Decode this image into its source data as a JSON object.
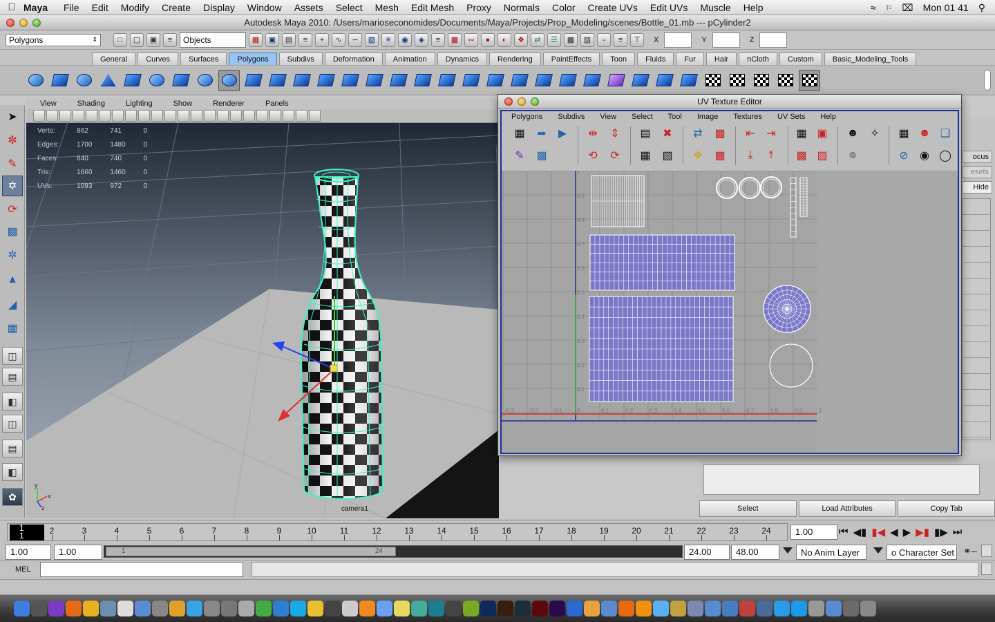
{
  "mac_menubar": {
    "app_name": "Maya",
    "items": [
      "File",
      "Edit",
      "Modify",
      "Create",
      "Display",
      "Window",
      "Assets",
      "Select",
      "Mesh",
      "Edit Mesh",
      "Proxy",
      "Normals",
      "Color",
      "Create UVs",
      "Edit UVs",
      "Muscle",
      "Help"
    ],
    "clock": "Mon 01 41"
  },
  "window": {
    "title": "Autodesk Maya 2010: /Users/marioseconomides/Documents/Maya/Projects/Prop_Modeling/scenes/Bottle_01.mb   ---   pCylinder2"
  },
  "status_line": {
    "menu_set": "Polygons",
    "selection_mode": "Objects",
    "x_label": "X",
    "y_label": "Y",
    "z_label": "Z"
  },
  "shelf_tabs": [
    "General",
    "Curves",
    "Surfaces",
    "Polygons",
    "Subdivs",
    "Deformation",
    "Animation",
    "Dynamics",
    "Rendering",
    "PaintEffects",
    "Toon",
    "Fluids",
    "Fur",
    "Hair",
    "nCloth",
    "Custom",
    "Basic_Modeling_Tools"
  ],
  "active_shelf_tab": "Polygons",
  "viewport": {
    "menu": [
      "View",
      "Shading",
      "Lighting",
      "Show",
      "Renderer",
      "Panels"
    ],
    "hud": [
      {
        "label": "Verts:",
        "a": "862",
        "b": "741",
        "c": "0"
      },
      {
        "label": "Edges:",
        "a": "1700",
        "b": "1480",
        "c": "0"
      },
      {
        "label": "Faces:",
        "a": "840",
        "b": "740",
        "c": "0"
      },
      {
        "label": "Tris:",
        "a": "1660",
        "b": "1460",
        "c": "0"
      },
      {
        "label": "UVs:",
        "a": "1093",
        "b": "972",
        "c": "0"
      }
    ],
    "camera_label": "camera1",
    "axis_labels": {
      "x": "x",
      "y": "y",
      "z": "z"
    },
    "grid_color": "#5e6a7a",
    "selection_color": "#3ef2c6"
  },
  "uv_editor": {
    "title": "UV Texture Editor",
    "menu": [
      "Polygons",
      "Subdivs",
      "View",
      "Select",
      "Tool",
      "Image",
      "Textures",
      "UV Sets",
      "Help"
    ],
    "v_labels": [
      "1",
      "0.9",
      "0.8",
      "0.7",
      "0.6",
      "0.5",
      "0.4",
      "0.3",
      "0.2",
      "0.1"
    ],
    "u_labels": [
      "-0.3",
      "-0.2",
      "-0.1",
      "0",
      "0.1",
      "0.2",
      "0.3",
      "0.4",
      "0.5",
      "0.6",
      "0.7",
      "0.8",
      "0.9",
      "1"
    ],
    "shell_fill": "#7b78c8"
  },
  "attribute_editor": {
    "tabs": [
      "ocus",
      "esets"
    ],
    "hide_button": "Hide",
    "buttons": [
      "Select",
      "Load Attributes",
      "Copy Tab"
    ]
  },
  "time_slider": {
    "frame_labels": [
      "2",
      "3",
      "4",
      "5",
      "6",
      "7",
      "8",
      "9",
      "10",
      "11",
      "12",
      "13",
      "14",
      "15",
      "16",
      "17",
      "18",
      "19",
      "20",
      "21",
      "22",
      "23",
      "24"
    ],
    "current_frame": "1",
    "current_frame_field": "1.00"
  },
  "range_slider": {
    "start_time": "1.00",
    "playback_start": "1.00",
    "handle_start": "1",
    "handle_end": "24",
    "playback_end": "24.00",
    "end_time": "48.00",
    "anim_layer": "No Anim Layer",
    "character_set": "o Character Set"
  },
  "command_line": {
    "label": "MEL"
  },
  "dock_icons": [
    "Finder",
    "Dashboard",
    "iTunes",
    "Firefox",
    "Chrome",
    "Preview",
    "Calendar",
    "Mail",
    "Photos",
    "GarageBand",
    "Safari",
    "System",
    "Utility",
    "Uranus",
    "Torrent",
    "Share",
    "Skype",
    "Vector",
    "Film",
    "Circle",
    "Burn",
    "Mail2",
    "Stickies",
    "Flip",
    "Maya",
    "Mudbox",
    "Scroll",
    "Photoshop",
    "Illustrator",
    "After Effects",
    "Flash",
    "Premiere",
    "Unity",
    "Pages",
    "Folder",
    "VLC",
    "Blender",
    "Glass",
    "Nuke",
    "Utilities",
    "Folder2",
    "Folder3",
    "Music",
    "Network",
    "Search",
    "Skype2",
    "Trash2",
    "Downloads",
    "Stacks",
    "Trash"
  ]
}
